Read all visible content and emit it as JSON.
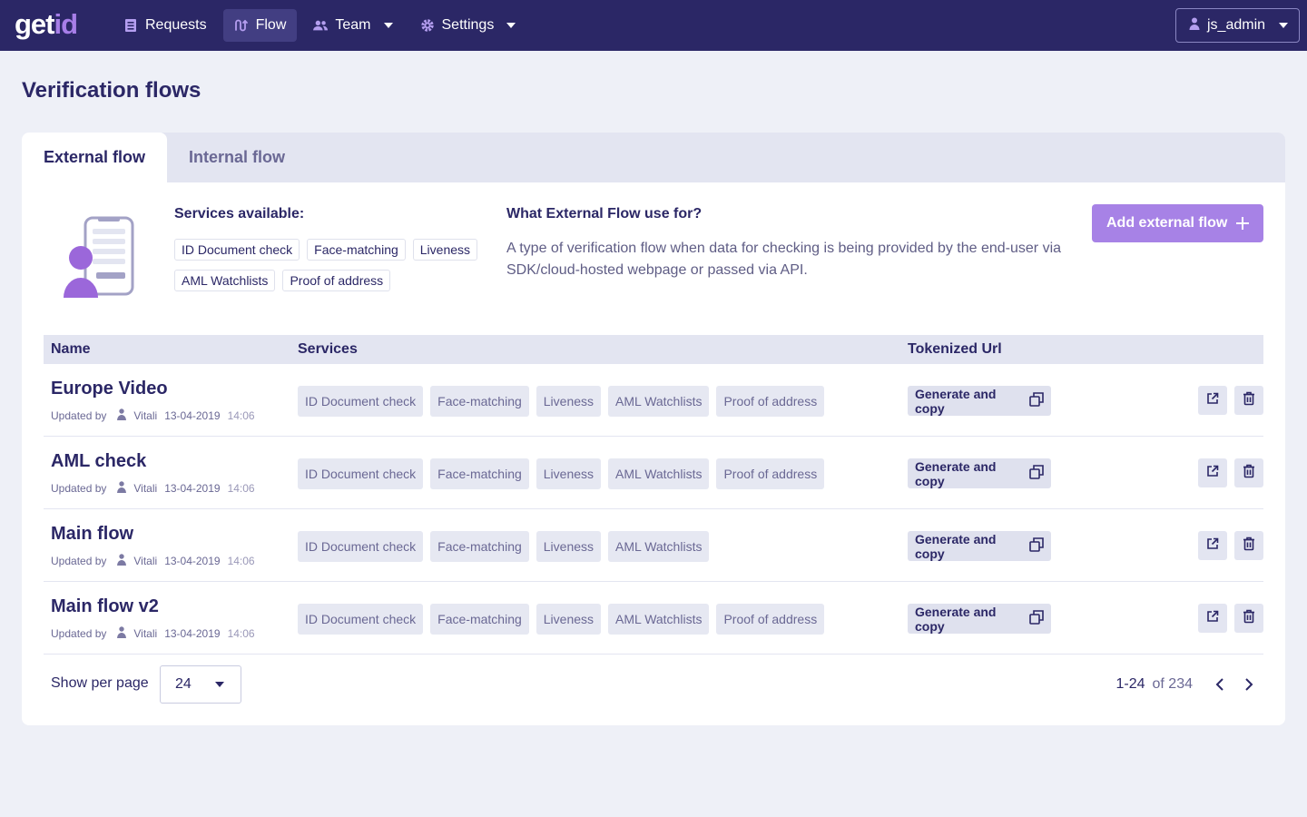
{
  "brand": {
    "logo_get": "get",
    "logo_id": "id"
  },
  "nav": {
    "items": [
      {
        "label": "Requests",
        "icon": "list-icon"
      },
      {
        "label": "Flow",
        "icon": "flow-icon"
      },
      {
        "label": "Team",
        "icon": "team-icon"
      },
      {
        "label": "Settings",
        "icon": "gear-icon"
      }
    ],
    "user": "js_admin"
  },
  "page_title": "Verification flows",
  "tabs": [
    {
      "label": "External flow"
    },
    {
      "label": "Internal flow"
    }
  ],
  "info": {
    "services_title": "Services available:",
    "services": [
      "ID Document check",
      "Face-matching",
      "Liveness",
      "AML Watchlists",
      "Proof of address"
    ],
    "question": "What External Flow use for?",
    "description": "A type of verification flow when data for checking is being provided by the end-user via SDK/cloud-hosted webpage or passed via API.",
    "add_button": "Add external flow"
  },
  "table": {
    "columns": [
      "Name",
      "Services",
      "Tokenized Url"
    ],
    "generate_label": "Generate and copy",
    "updated_by_label": "Updated by",
    "rows": [
      {
        "name": "Europe Video",
        "user": "Vitali",
        "date": "13-04-2019",
        "time": "14:06",
        "services": [
          "ID Document check",
          "Face-matching",
          "Liveness",
          "AML Watchlists",
          "Proof of address"
        ]
      },
      {
        "name": "AML check",
        "user": "Vitali",
        "date": "13-04-2019",
        "time": "14:06",
        "services": [
          "ID Document check",
          "Face-matching",
          "Liveness",
          "AML Watchlists",
          "Proof of address"
        ]
      },
      {
        "name": "Main flow",
        "user": "Vitali",
        "date": "13-04-2019",
        "time": "14:06",
        "services": [
          "ID Document check",
          "Face-matching",
          "Liveness",
          "AML Watchlists"
        ]
      },
      {
        "name": "Main flow v2",
        "user": "Vitali",
        "date": "13-04-2019",
        "time": "14:06",
        "services": [
          "ID Document check",
          "Face-matching",
          "Liveness",
          "AML Watchlists",
          "Proof of address"
        ]
      }
    ]
  },
  "footer": {
    "per_page_label": "Show per page",
    "per_page_value": "24",
    "range": "1-24",
    "of_total": "of 234"
  },
  "colors": {
    "topbar": "#2b2766",
    "accent": "#a782e6",
    "text": "#2b2766"
  }
}
